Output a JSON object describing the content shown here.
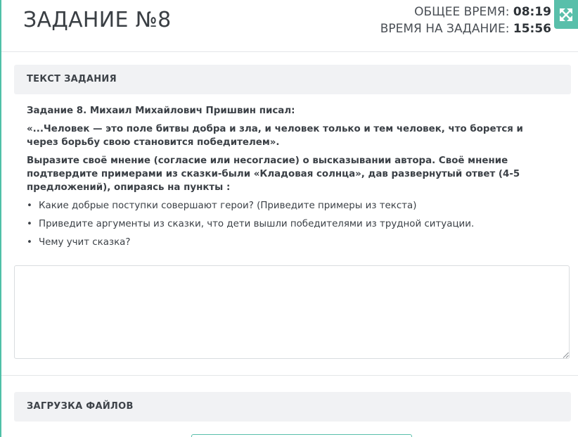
{
  "header": {
    "title": "ЗАДАНИЕ №8",
    "total_time_label": "ОБЩЕЕ ВРЕМЯ:",
    "total_time_value": "08:19",
    "task_time_label": "ВРЕМЯ НА ЗАДАНИЕ:",
    "task_time_value": "15:56",
    "expand_icon": "expand-arrows-icon"
  },
  "task_section": {
    "heading": "ТЕКСТ ЗАДАНИЯ",
    "intro": "Задание 8. Михаил Михайлович Пришвин писал:",
    "quote": "«...Человек — это поле битвы добра и зла, и человек только и тем человек, что борется и через борьбу свою становится победителем».",
    "instruction": "Выразите своё мнение (согласие или несогласие) о высказывании автора. Своё мнение подтвердите примерами из сказки-были «Кладовая солнца», дав развернутый ответ (4-5 предложений), опираясь на пункты :",
    "points": [
      "Какие добрые поступки совершают герои? (Приведите примеры из текста)",
      "Приведите аргументы из сказки, что дети вышли победителями из трудной ситуации.",
      "Чему учит сказка?"
    ]
  },
  "answer": {
    "value": ""
  },
  "upload_section": {
    "heading": "ЗАГРУЗКА ФАЙЛОВ"
  },
  "colors": {
    "accent": "#59bfaa",
    "section_bg": "#f1f2f4",
    "text": "#3b4046"
  }
}
